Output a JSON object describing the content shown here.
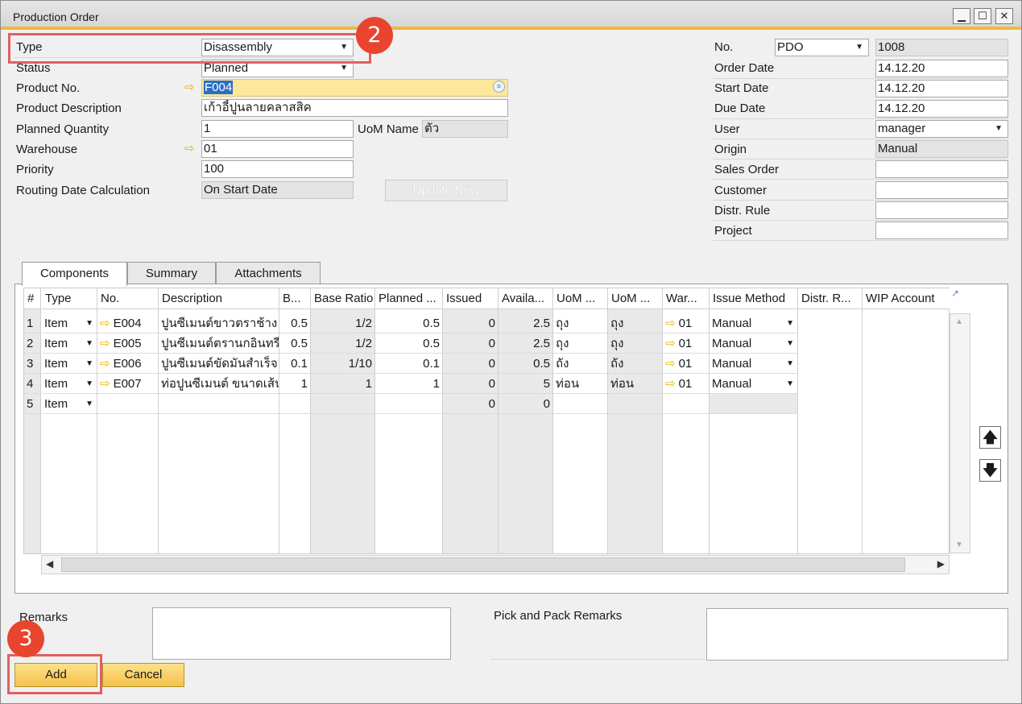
{
  "window": {
    "title": "Production Order",
    "min": "▁",
    "max": "☐",
    "close": "✕"
  },
  "header": {
    "type": {
      "label": "Type",
      "value": "Disassembly"
    },
    "status": {
      "label": "Status",
      "value": "Planned"
    },
    "product_no": {
      "label": "Product No.",
      "value": "F004"
    },
    "product_desc": {
      "label": "Product Description",
      "value": "เก้าอี้ปูนลายคลาสสิค"
    },
    "planned_qty": {
      "label": "Planned Quantity",
      "value": "1"
    },
    "uom_name": {
      "label": "UoM Name",
      "value": "ตัว"
    },
    "warehouse": {
      "label": "Warehouse",
      "value": "01"
    },
    "priority": {
      "label": "Priority",
      "value": "100"
    },
    "routing": {
      "label": "Routing Date Calculation",
      "value": "On Start Date"
    },
    "update_now": "Update Now"
  },
  "right_header": {
    "no": {
      "label": "No.",
      "series": "PDO",
      "value": "1008"
    },
    "order_date": {
      "label": "Order Date",
      "value": "14.12.20"
    },
    "start_date": {
      "label": "Start Date",
      "value": "14.12.20"
    },
    "due_date": {
      "label": "Due Date",
      "value": "14.12.20"
    },
    "user": {
      "label": "User",
      "value": "manager"
    },
    "origin": {
      "label": "Origin",
      "value": "Manual"
    },
    "sales_order": {
      "label": "Sales Order",
      "value": ""
    },
    "customer": {
      "label": "Customer",
      "value": ""
    },
    "distr_rule": {
      "label": "Distr. Rule",
      "value": ""
    },
    "project": {
      "label": "Project",
      "value": ""
    }
  },
  "tabs": [
    {
      "label": "Components"
    },
    {
      "label": "Summary"
    },
    {
      "label": "Attachments"
    }
  ],
  "grid": {
    "columns": [
      "#",
      "Type",
      "No.",
      "Description",
      "B...",
      "Base Ratio",
      "Planned ...",
      "Issued",
      "Availa...",
      "UoM ...",
      "UoM ...",
      "War...",
      "Issue Method",
      "Distr. R...",
      "WIP Account"
    ],
    "rows": [
      {
        "n": "1",
        "type": "Item",
        "no": "E004",
        "desc": "ปูนซีเมนต์ขาวตราช้าง",
        "b": "0.5",
        "ratio": "1/2",
        "planned": "0.5",
        "issued": "0",
        "avail": "2.5",
        "uom1": "ถุง",
        "uom2": "ถุง",
        "wh": "01",
        "method": "Manual"
      },
      {
        "n": "2",
        "type": "Item",
        "no": "E005",
        "desc": "ปูนซีเมนต์ตรานกอินทรี",
        "b": "0.5",
        "ratio": "1/2",
        "planned": "0.5",
        "issued": "0",
        "avail": "2.5",
        "uom1": "ถุง",
        "uom2": "ถุง",
        "wh": "01",
        "method": "Manual"
      },
      {
        "n": "3",
        "type": "Item",
        "no": "E006",
        "desc": "ปูนซีเมนต์ขัดมันสำเร็จ",
        "b": "0.1",
        "ratio": "1/10",
        "planned": "0.1",
        "issued": "0",
        "avail": "0.5",
        "uom1": "ถัง",
        "uom2": "ถัง",
        "wh": "01",
        "method": "Manual"
      },
      {
        "n": "4",
        "type": "Item",
        "no": "E007",
        "desc": "ท่อปูนซีเมนต์ ขนาดเส้น",
        "b": "1",
        "ratio": "1",
        "planned": "1",
        "issued": "0",
        "avail": "5",
        "uom1": "ท่อน",
        "uom2": "ท่อน",
        "wh": "01",
        "method": "Manual"
      },
      {
        "n": "5",
        "type": "Item",
        "no": "",
        "desc": "",
        "b": "",
        "ratio": "",
        "planned": "",
        "issued": "0",
        "avail": "0",
        "uom1": "",
        "uom2": "",
        "wh": "",
        "method": ""
      }
    ]
  },
  "footer": {
    "remarks_label": "Remarks",
    "pick_pack_label": "Pick and Pack Remarks",
    "add": "Add",
    "cancel": "Cancel"
  },
  "annotations": {
    "badge2": "2",
    "badge3": "3"
  },
  "colors": {
    "accent": "#f4b73a",
    "highlight_field": "#fbe89a",
    "callout": "#e06060",
    "badge": "#e8442e"
  }
}
